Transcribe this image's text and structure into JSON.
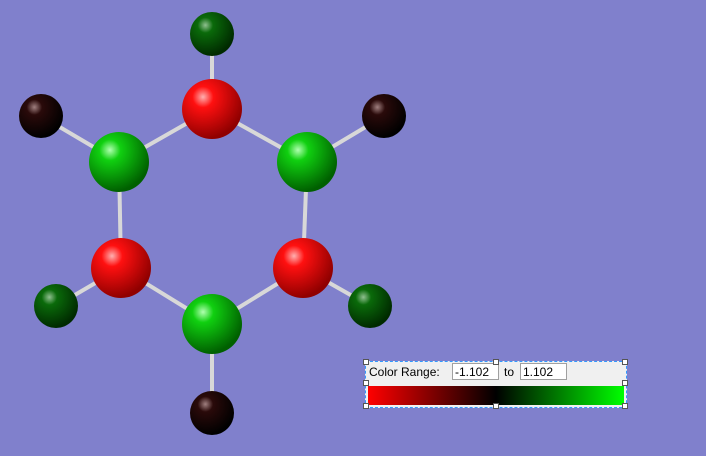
{
  "color_range": {
    "label": "Color Range:",
    "min": "-1.102",
    "to_label": "to",
    "max": "1.102",
    "gradient_colors": [
      "#ff0000",
      "#000000",
      "#00ff00"
    ]
  },
  "colors": {
    "background": "#8080cc",
    "bond": "#d8d8d8"
  }
}
